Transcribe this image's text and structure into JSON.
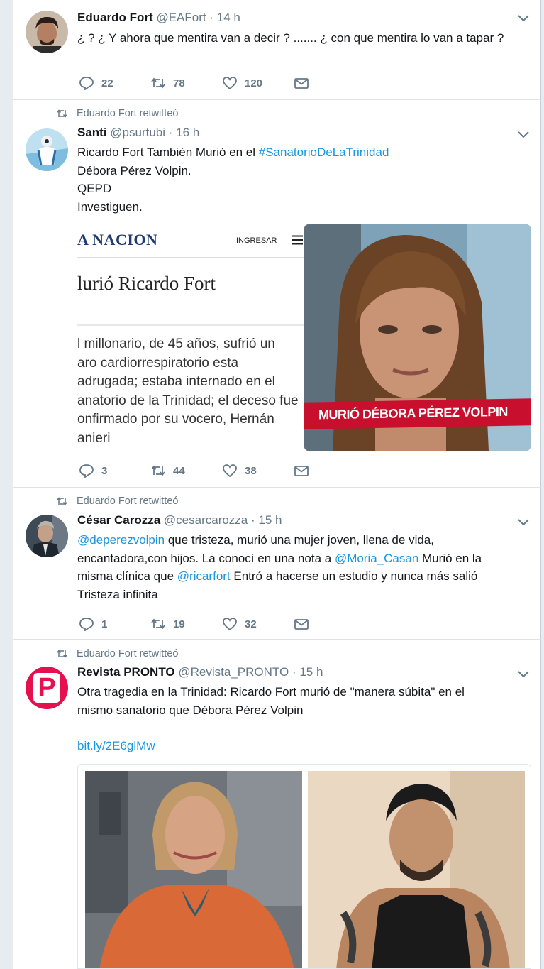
{
  "tweets": [
    {
      "name": "Eduardo Fort",
      "handle": "@EAFort",
      "dot": "·",
      "time": "14 h",
      "text_plain": "¿ ?   ¿ Y ahora que mentira van a decir ? ....... ¿ con que mentira lo van a tapar ?",
      "replies": "22",
      "retweets": "78",
      "likes": "120"
    },
    {
      "retweet_label": "Eduardo Fort retwitteó",
      "name": "Santi",
      "handle": "@psurtubi",
      "dot": "·",
      "time": "16 h",
      "text_pre": "Ricardo Fort También Murió en el ",
      "hashtag": "#SanatorioDeLaTrinidad",
      "line2": "Débora Pérez Volpin.",
      "line3": "QEPD",
      "line4": "Investiguen.",
      "media": {
        "brand": "A NACION",
        "login": "INGRESAR",
        "headline": "lurió Ricardo Fort",
        "body": [
          "l millonario, de 45 años, sufrió un",
          "aro cardiorrespiratorio esta",
          "adrugada; estaba internado en el",
          "anatorio de la Trinidad; el deceso fue",
          "onfirmado por su vocero, Hernán",
          "anieri"
        ],
        "tv_caption": "MURIÓ DÉBORA PÉREZ VOLPIN"
      },
      "replies": "3",
      "retweets": "44",
      "likes": "38"
    },
    {
      "retweet_label": "Eduardo Fort retwitteó",
      "name": "César Carozza",
      "handle": "@cesarcarozza",
      "dot": "·",
      "time": "15 h",
      "mention1": "@deperezvolpin",
      "t1": " que tristeza, murió una mujer joven, llena de vida,",
      "t2": "encantadora,con hijos. La conocí en una nota a ",
      "mention2": "@Moria_Casan",
      "t3": " Murió en la",
      "t4": "misma clínica que ",
      "mention3": "@ricarfort",
      "t5": " Entró a hacerse un estudio y nunca más salió",
      "t6": "Tristeza infinita",
      "replies": "1",
      "retweets": "19",
      "likes": "32"
    },
    {
      "retweet_label": "Eduardo Fort retwitteó",
      "name": "Revista PRONTO",
      "handle": "@Revista_PRONTO",
      "dot": "·",
      "time": "15 h",
      "avatar_letter": "P",
      "line1": "Otra tragedia en la Trinidad: Ricardo Fort murió de \"manera súbita\" en el",
      "line2": "mismo sanatorio que Débora Pérez Volpin",
      "url": "bit.ly/2E6glMw"
    }
  ],
  "colors": {
    "link": "#1b95e0",
    "muted": "#657786",
    "red_banner": "#c8102e",
    "pronto": "#e4104f"
  }
}
